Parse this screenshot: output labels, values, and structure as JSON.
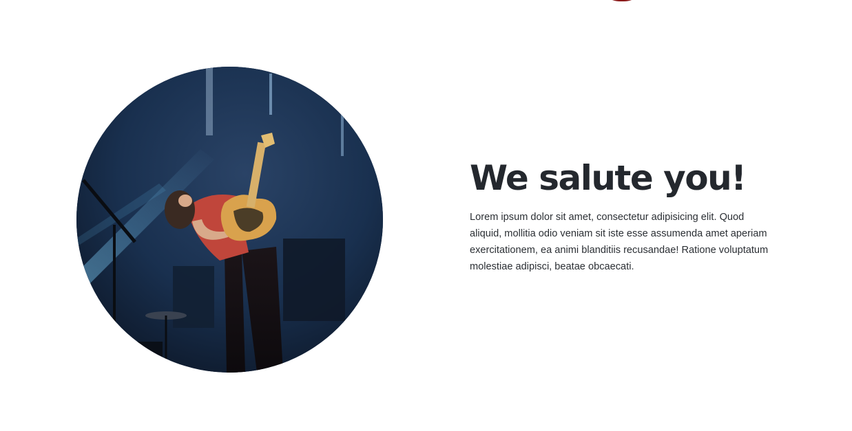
{
  "section": {
    "heading": "We salute you!",
    "body": "Lorem ipsum dolor sit amet, consectetur adipisicing elit. Quod aliquid, mollitia odio veniam sit iste esse assumenda amet aperiam exercitationem, ea animi blanditiis recusandae! Ratione voluptatum molestiae adipisci, beatae obcaecati."
  },
  "colors": {
    "heading": "#24282e",
    "body_text": "#2b2f34",
    "background": "#ffffff",
    "stage_blue": "#14243b",
    "accent_red": "#8b1a1a"
  },
  "image": {
    "subject": "guitarist-on-stage-photo",
    "shape": "circle"
  }
}
